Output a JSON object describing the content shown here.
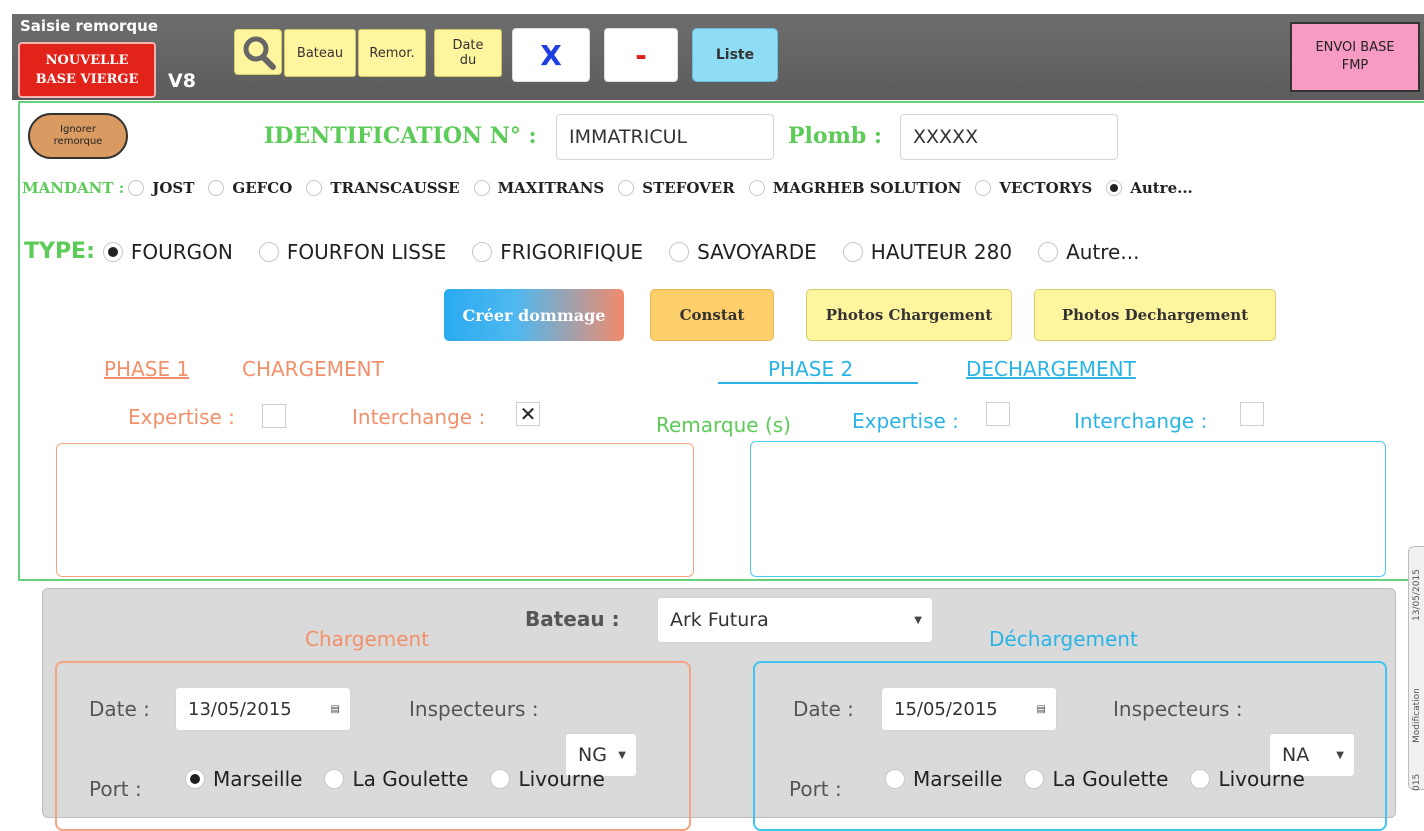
{
  "toolbar": {
    "title": "Saisie remorque",
    "new_base_line1": "NOUVELLE",
    "new_base_line2": "BASE VIERGE",
    "version": "V8",
    "bateau": "Bateau",
    "remor": "Remor.",
    "date_line1": "Date",
    "date_line2": "du",
    "x_label": "X",
    "minus_label": "-",
    "liste": "Liste",
    "envoi_line1": "ENVOI BASE",
    "envoi_line2": "FMP"
  },
  "ident": {
    "ignore_line1": "Ignorer",
    "ignore_line2": "remorque",
    "id_label": "IDENTIFICATION N° :",
    "id_value": "IMMATRICUL",
    "plomb_label": "Plomb :",
    "plomb_value": "XXXXX",
    "mandant_label": "MANDANT :",
    "mandants": [
      "JOST",
      "GEFCO",
      "TRANSCAUSSE",
      "MAXITRANS",
      "STEFOVER",
      "MAGRHEB SOLUTION",
      "VECTORYS",
      "Autre..."
    ],
    "mandant_selected": 7,
    "type_label": "TYPE:",
    "types": [
      "FOURGON",
      "FOURFON LISSE",
      "FRIGORIFIQUE",
      "SAVOYARDE",
      "HAUTEUR 280",
      "Autre..."
    ],
    "type_selected": 0
  },
  "actions": {
    "create": "Créer dommage",
    "constat": "Constat",
    "photos_chargement": "Photos Chargement",
    "photos_dechargement": "Photos Dechargement"
  },
  "phase1": {
    "phase": "PHASE 1",
    "title": "CHARGEMENT",
    "expertise": "Expertise :",
    "interchange": "Interchange :",
    "interchange_mark": "✕"
  },
  "remarque": "Remarque (s)",
  "phase2": {
    "phase": "PHASE 2",
    "title": "DECHARGEMENT",
    "expertise": "Expertise :",
    "interchange": "Interchange :"
  },
  "lower": {
    "bateau_label": "Bateau :",
    "bateau_value": "Ark Futura",
    "chargement": "Chargement",
    "dechargement": "Déchargement",
    "date_label": "Date :",
    "date_charg": "13/05/2015",
    "date_decharg": "15/05/2015",
    "inspecteurs_label": "Inspecteurs :",
    "insp_charg": "NG",
    "insp_decharg": "NA",
    "port_label": "Port :",
    "ports": [
      "Marseille",
      "La Goulette",
      "Livourne"
    ],
    "port_charg_selected": 0
  },
  "side_tab": {
    "date": "13/05/2015",
    "label": "Modification",
    "num": "015"
  }
}
